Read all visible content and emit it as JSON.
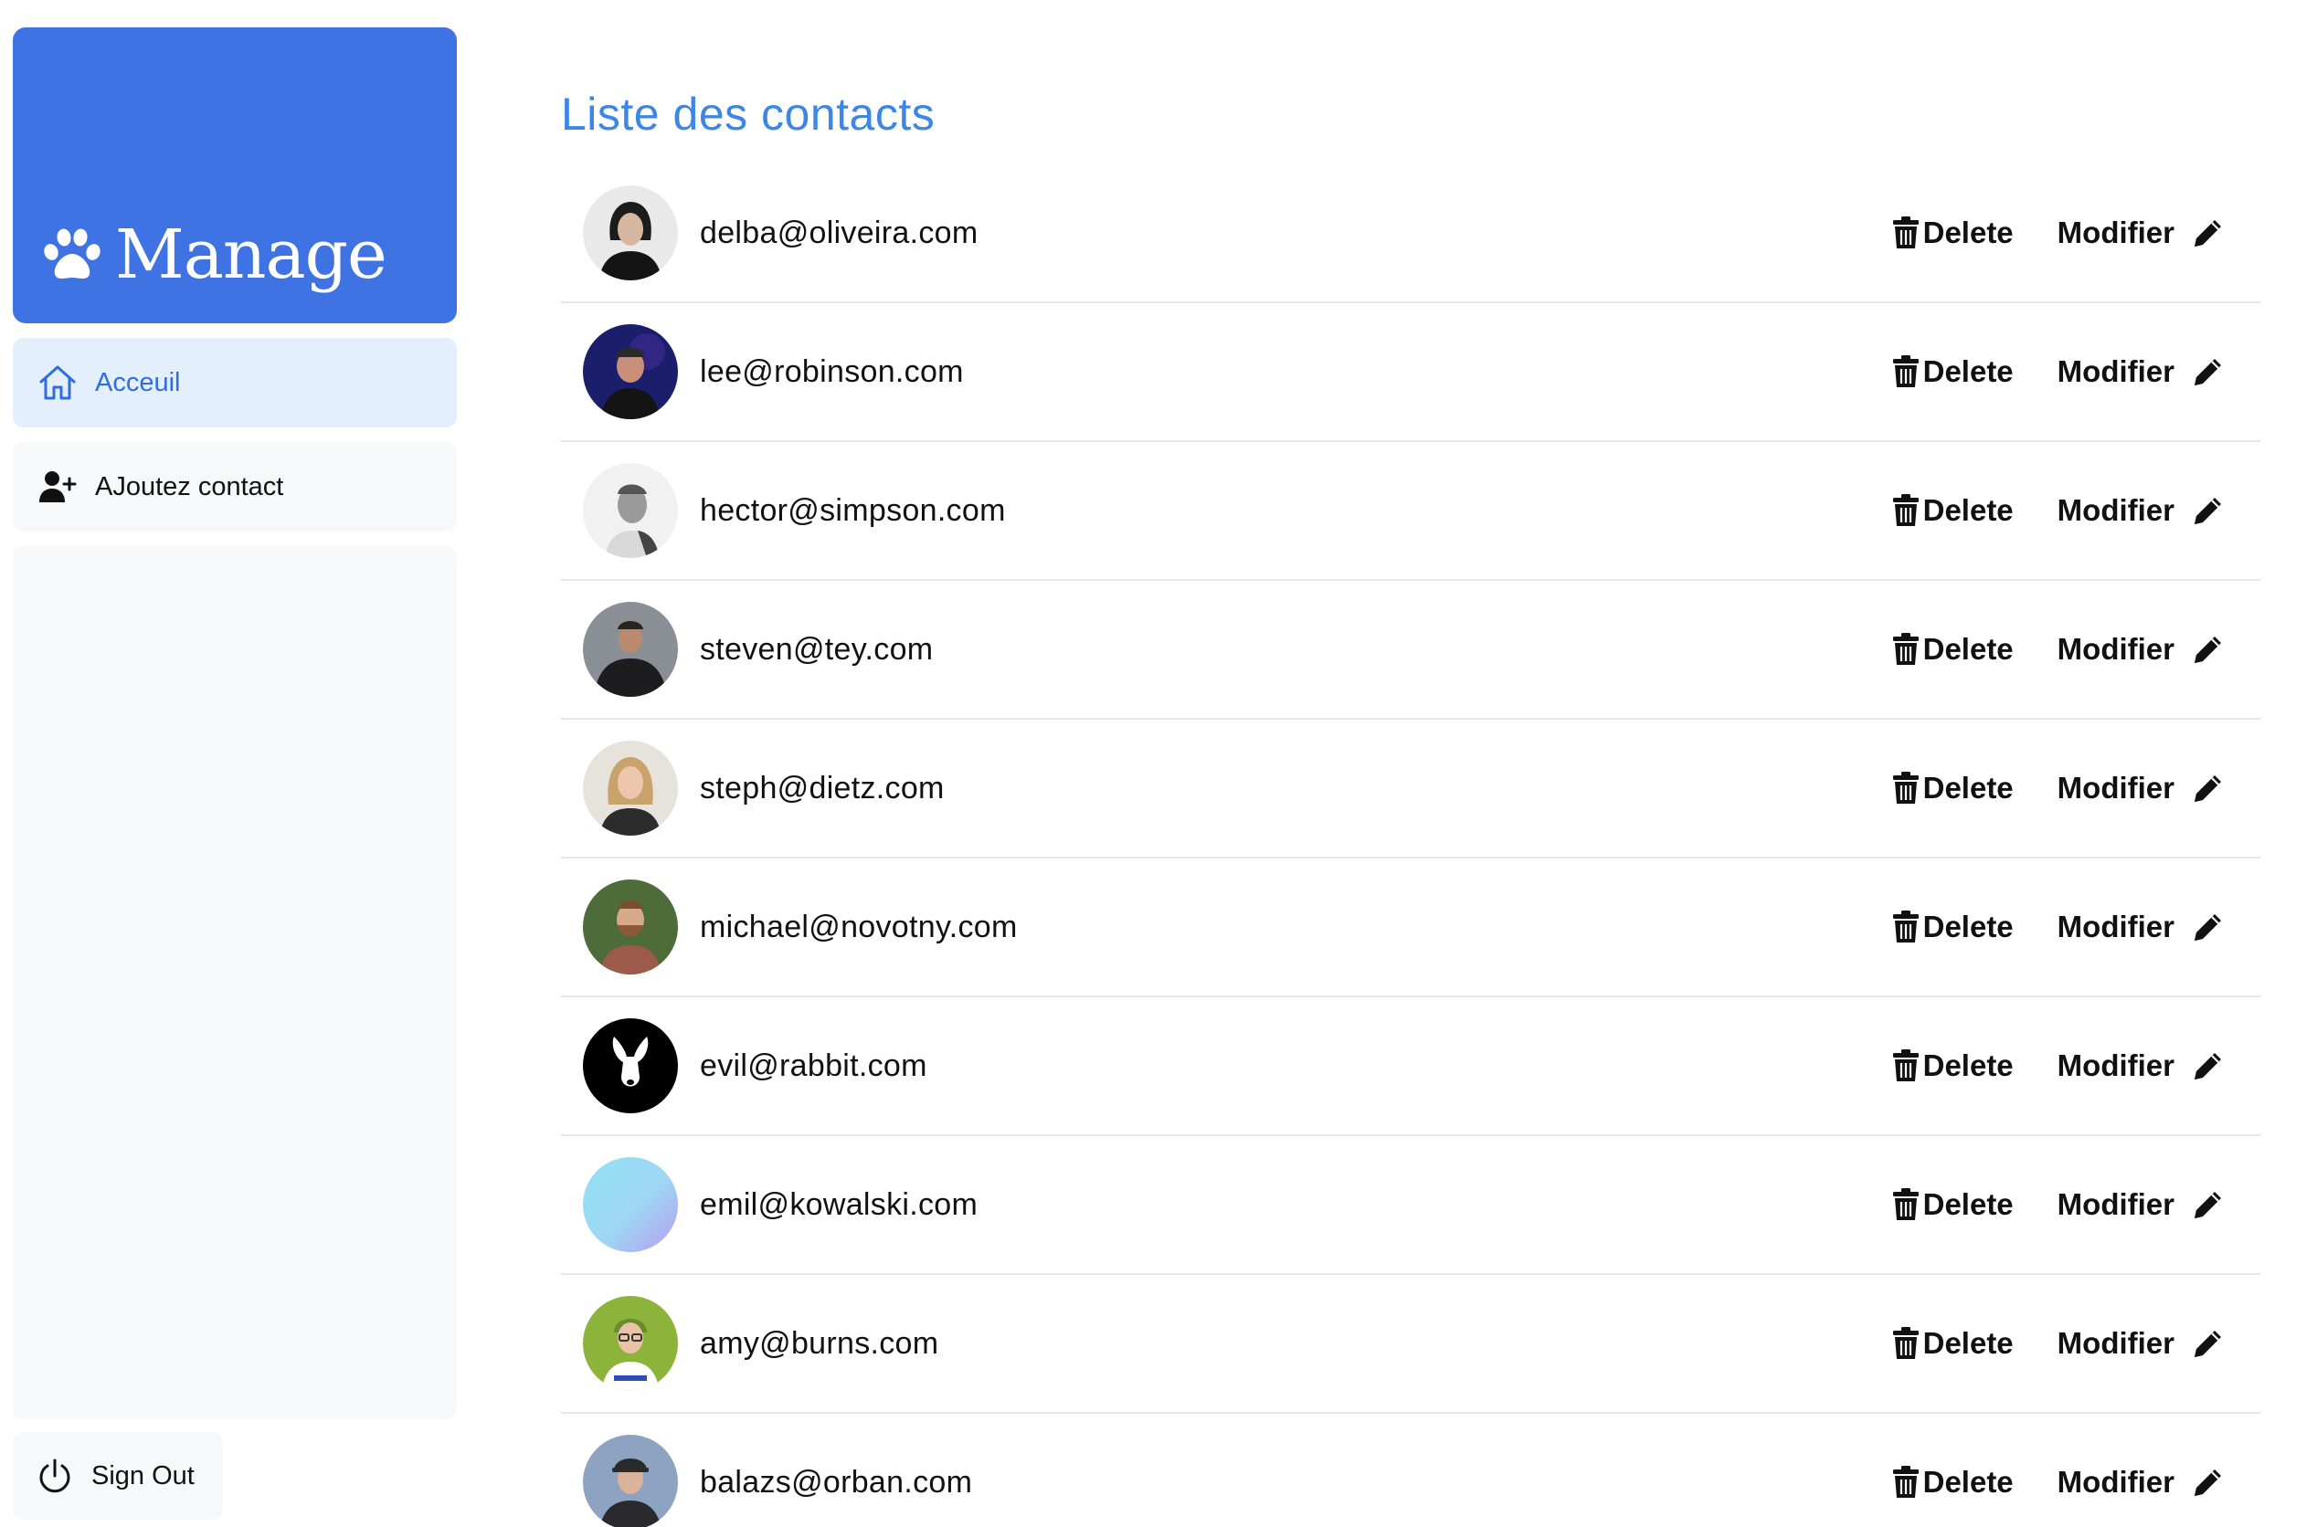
{
  "brand": {
    "name": "Manage",
    "icon": "paw-icon",
    "color": "#3f73e3"
  },
  "sidebar": {
    "items": [
      {
        "label": "Acceuil",
        "icon": "home-icon",
        "active": true
      },
      {
        "label": "AJoutez contact",
        "icon": "user-plus-icon",
        "active": false
      }
    ],
    "signout": {
      "label": "Sign Out",
      "icon": "power-icon"
    }
  },
  "main": {
    "title": "Liste des contacts",
    "delete_label": "Delete",
    "modify_label": "Modifier",
    "contacts": [
      {
        "email": "delba@oliveira.com"
      },
      {
        "email": "lee@robinson.com"
      },
      {
        "email": "hector@simpson.com"
      },
      {
        "email": "steven@tey.com"
      },
      {
        "email": "steph@dietz.com"
      },
      {
        "email": "michael@novotny.com"
      },
      {
        "email": "evil@rabbit.com"
      },
      {
        "email": "emil@kowalski.com"
      },
      {
        "email": "amy@burns.com"
      },
      {
        "email": "balazs@orban.com"
      }
    ]
  },
  "colors": {
    "accent": "#3d86e6",
    "active_bg": "#e3effd",
    "panel_bg": "#f7f8fa",
    "divider": "#e5e7eb"
  }
}
